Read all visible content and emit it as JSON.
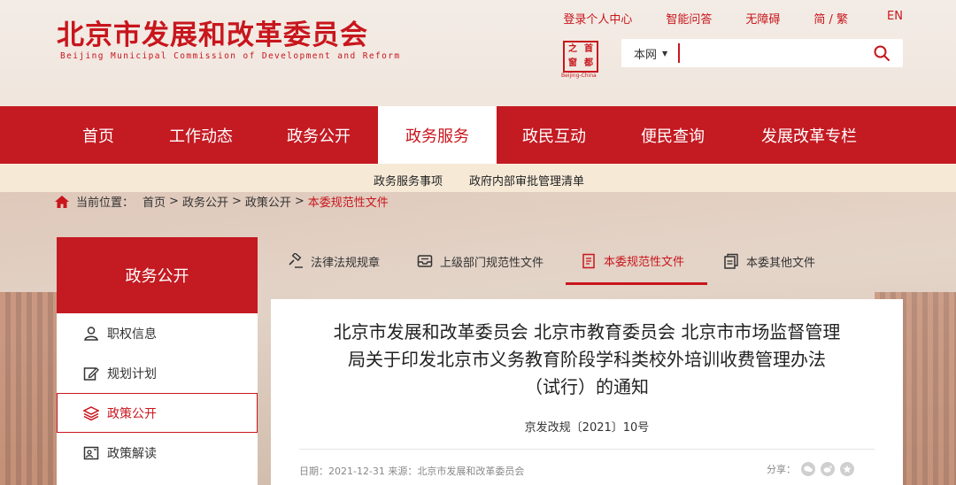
{
  "header": {
    "title": "北京市发展和改革委员会",
    "subtitle": "Beijing Municipal Commission of Development and Reform",
    "top_links": [
      "登录个人中心",
      "智能问答",
      "无障碍",
      "简 / 繁",
      "EN"
    ],
    "seal": [
      "之",
      "首",
      "窗",
      "都"
    ],
    "seal_caption": "Beijing-China"
  },
  "search": {
    "scope": "本网",
    "placeholder": ""
  },
  "main_nav": [
    "首页",
    "工作动态",
    "政务公开",
    "政务服务",
    "政民互动",
    "便民查询",
    "发展改革专栏"
  ],
  "main_nav_active": "政务服务",
  "sub_nav": [
    "政务服务事项",
    "政府内部审批管理清单"
  ],
  "breadcrumb": {
    "label": "当前位置：",
    "items": [
      "首页",
      "政务公开",
      "政策公开"
    ],
    "current": "本委规范性文件"
  },
  "sidebar": {
    "title": "政务公开",
    "items": [
      {
        "label": "职权信息",
        "icon": "person-icon"
      },
      {
        "label": "规划计划",
        "icon": "edit-icon"
      },
      {
        "label": "政策公开",
        "icon": "layers-icon"
      },
      {
        "label": "政策解读",
        "icon": "interpret-icon"
      }
    ],
    "active": "政策公开"
  },
  "tabs": [
    {
      "label": "法律法规规章",
      "icon": "gavel-icon"
    },
    {
      "label": "上级部门规范性文件",
      "icon": "inbox-icon"
    },
    {
      "label": "本委规范性文件",
      "icon": "document-icon"
    },
    {
      "label": "本委其他文件",
      "icon": "files-icon"
    }
  ],
  "tabs_active": "本委规范性文件",
  "article": {
    "title_lines": [
      "北京市发展和改革委员会 北京市教育委员会 北京市市场监督管理",
      "局关于印发北京市义务教育阶段学科类校外培训收费管理办法",
      "（试行）的通知"
    ],
    "doc_number": "京发改规〔2021〕10号",
    "meta": "日期：2021-12-31  来源：北京市发展和改革委员会",
    "share_label": "分享："
  },
  "colors": {
    "brand_red": "#c41a22",
    "subnav_bg": "#f6ead7"
  }
}
